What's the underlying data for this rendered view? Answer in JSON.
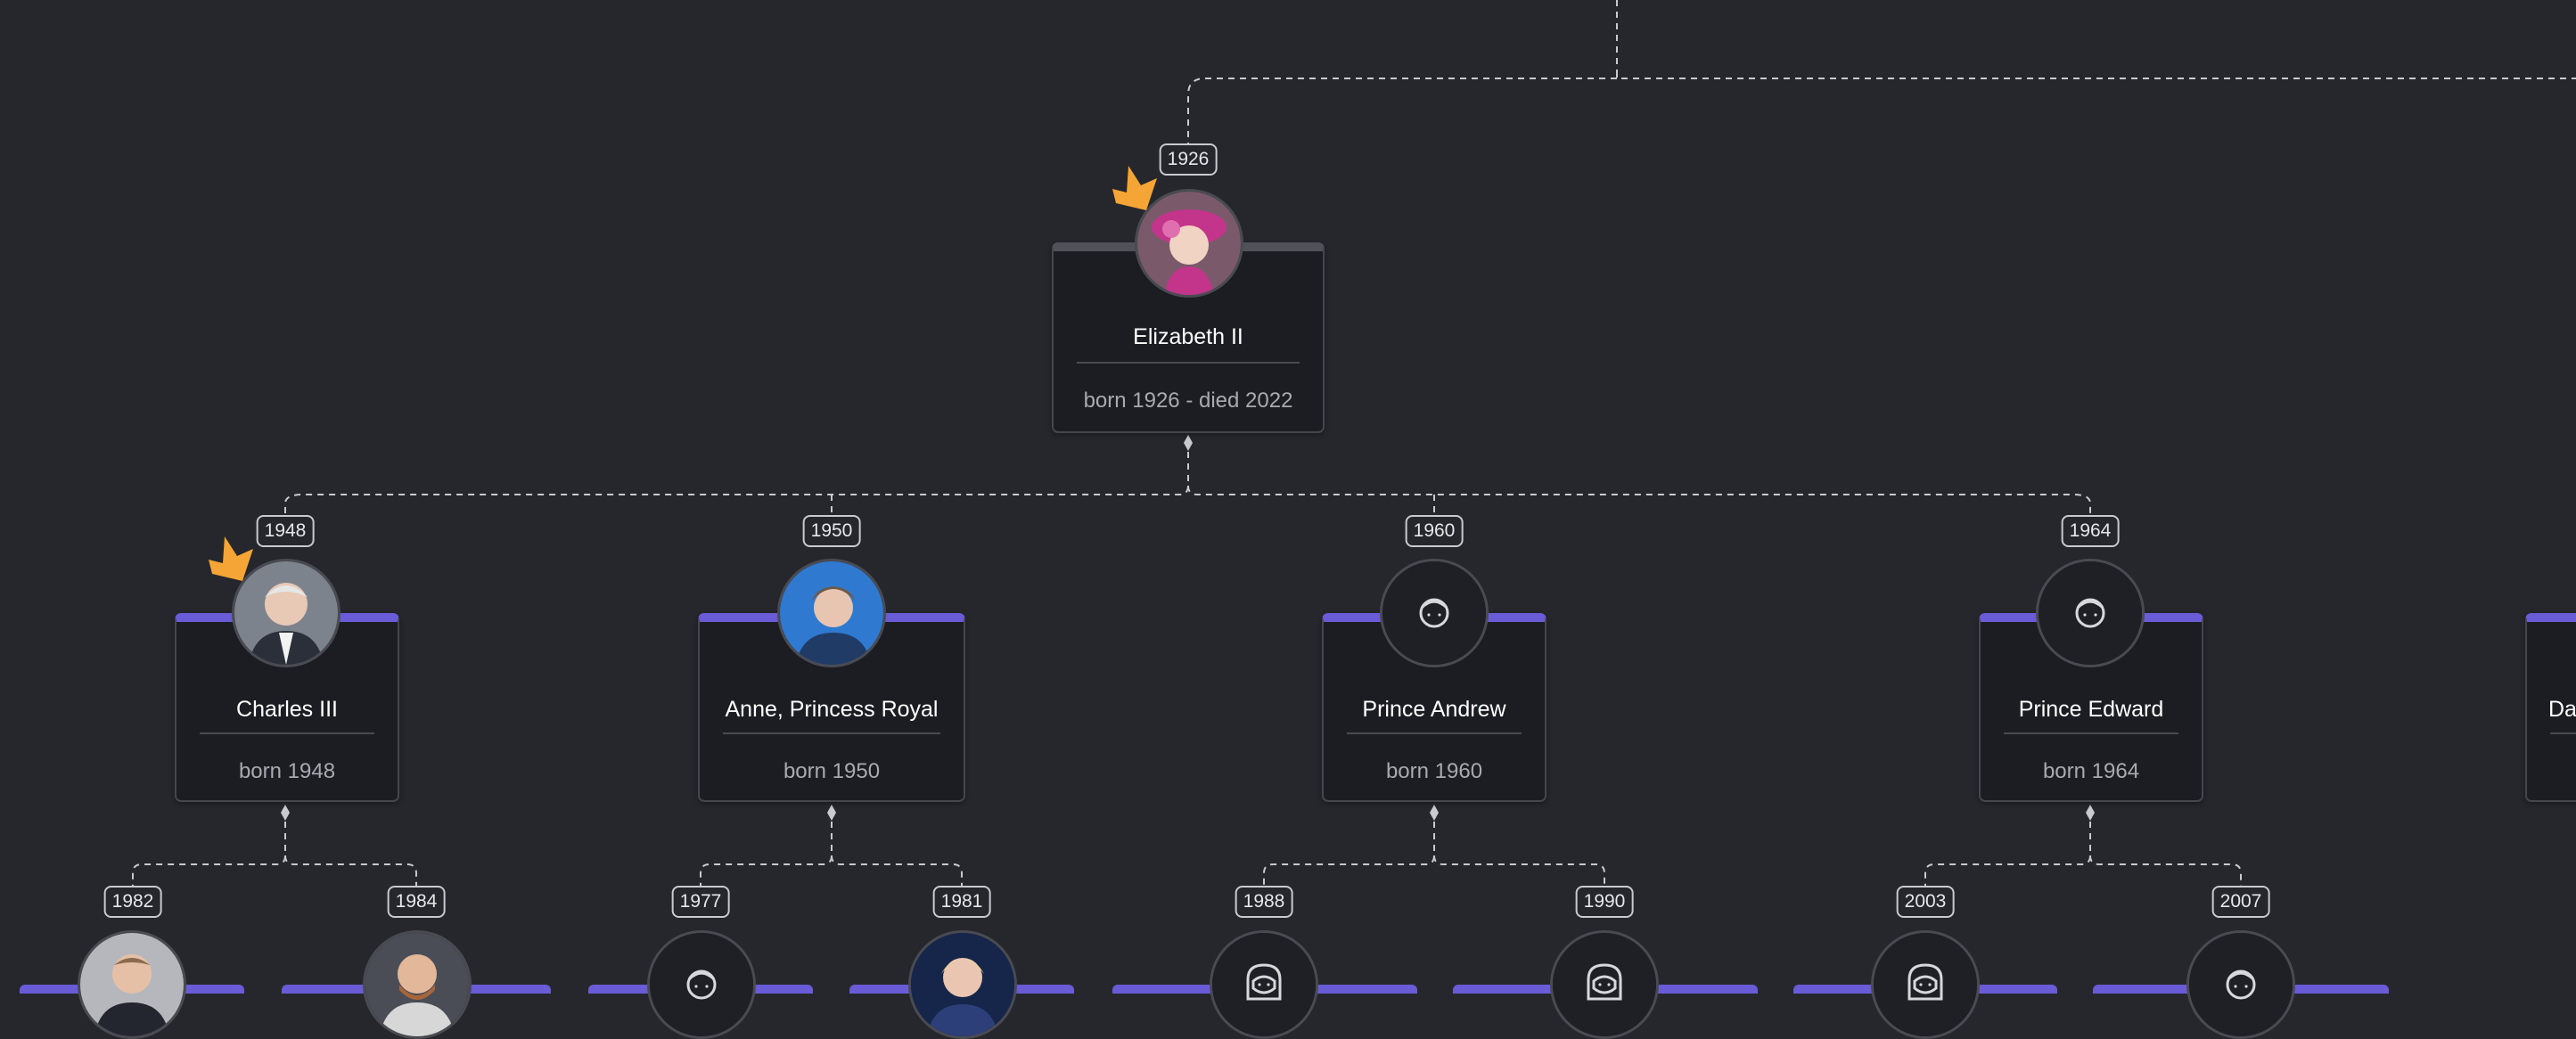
{
  "tree": {
    "root": {
      "name": "Elizabeth II",
      "dates": "born 1926 - died 2022",
      "year": "1926",
      "avatar": "photo",
      "crown": true
    },
    "children": [
      {
        "name": "Charles III",
        "dates": "born 1948",
        "year": "1948",
        "avatar": "photo",
        "crown": true,
        "children": [
          {
            "year": "1982",
            "avatar": "photo"
          },
          {
            "year": "1984",
            "avatar": "photo"
          }
        ]
      },
      {
        "name": "Anne, Princess Royal",
        "dates": "born 1950",
        "year": "1950",
        "avatar": "photo",
        "crown": false,
        "children": [
          {
            "year": "1977",
            "avatar": "male-placeholder-icon"
          },
          {
            "year": "1981",
            "avatar": "photo"
          }
        ]
      },
      {
        "name": "Prince Andrew",
        "dates": "born 1960",
        "year": "1960",
        "avatar": "male-placeholder-icon",
        "crown": false,
        "children": [
          {
            "year": "1988",
            "avatar": "female-placeholder-icon"
          },
          {
            "year": "1990",
            "avatar": "female-placeholder-icon"
          }
        ]
      },
      {
        "name": "Prince Edward",
        "dates": "born 1964",
        "year": "1964",
        "avatar": "male-placeholder-icon",
        "crown": false,
        "children": [
          {
            "year": "2003",
            "avatar": "female-placeholder-icon"
          },
          {
            "year": "2007",
            "avatar": "male-placeholder-icon"
          }
        ]
      }
    ],
    "partial_sibling_name": "Da"
  },
  "colors": {
    "background": "#26272d",
    "card": "#1c1d22",
    "card_accent": "#6a5bd6",
    "root_accent": "#50525a",
    "connector": "#c9cad0",
    "crown": "#f4a535",
    "name_text": "#ffffff",
    "dates_text": "#a9aab1"
  }
}
